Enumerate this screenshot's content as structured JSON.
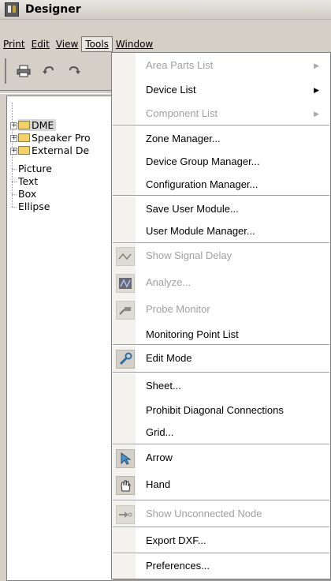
{
  "window": {
    "title": "Designer"
  },
  "menubar": [
    {
      "label": "Print",
      "underline": "P"
    },
    {
      "label": "Edit",
      "underline": "E"
    },
    {
      "label": "View",
      "underline": "V"
    },
    {
      "label": "Tools",
      "underline": "T"
    },
    {
      "label": "Window",
      "underline": "W"
    }
  ],
  "toolbar": {
    "print_icon": "printer-icon",
    "undo_icon": "undo-icon",
    "redo_icon": "redo-icon"
  },
  "tree": {
    "items": [
      {
        "label": "DME",
        "folder": true,
        "expandable": true,
        "selected": true
      },
      {
        "label": "Speaker Pro",
        "folder": true,
        "expandable": true
      },
      {
        "label": "External De",
        "folder": true,
        "expandable": true
      },
      {
        "label": "Picture"
      },
      {
        "label": "Text"
      },
      {
        "label": "Box"
      },
      {
        "label": "Ellipse"
      }
    ]
  },
  "tools_menu": {
    "items": [
      {
        "label": "Area Parts List",
        "disabled": true,
        "submenu": true
      },
      {
        "label": "Device List",
        "disabled": false,
        "submenu": true
      },
      {
        "label": "Component List",
        "disabled": true,
        "submenu": true
      },
      {
        "label": "Zone Manager...",
        "disabled": false
      },
      {
        "label": "Device Group Manager...",
        "disabled": false
      },
      {
        "label": "Configuration Manager...",
        "disabled": false
      },
      {
        "label": "Save User Module...",
        "disabled": false
      },
      {
        "label": "User Module Manager...",
        "disabled": false
      },
      {
        "label": "Show Signal Delay",
        "disabled": true,
        "icon": "signal-delay-icon"
      },
      {
        "label": "Analyze...",
        "disabled": true,
        "icon": "analyze-icon"
      },
      {
        "label": "Probe Monitor",
        "disabled": true,
        "icon": "probe-icon"
      },
      {
        "label": "Monitoring Point List",
        "disabled": false
      },
      {
        "label": "Edit Mode",
        "disabled": false,
        "icon": "wrench-icon"
      },
      {
        "label": "Sheet...",
        "disabled": false
      },
      {
        "label": "Prohibit Diagonal Connections",
        "disabled": false
      },
      {
        "label": "Grid...",
        "disabled": false
      },
      {
        "label": "Arrow",
        "disabled": false,
        "icon": "arrow-cursor-icon"
      },
      {
        "label": "Hand",
        "disabled": false,
        "icon": "hand-icon"
      },
      {
        "label": "Show Unconnected Node",
        "disabled": true,
        "icon": "unconnected-node-icon"
      },
      {
        "label": "Export DXF...",
        "disabled": false
      },
      {
        "label": "Preferences...",
        "disabled": false
      }
    ]
  }
}
